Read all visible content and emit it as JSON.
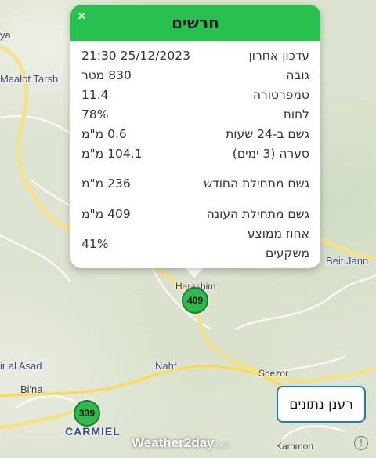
{
  "popup": {
    "title": "חרשים",
    "close_icon": "×",
    "rows": [
      {
        "label": "עדכון אחרון",
        "value": "25/12/2023 21:30"
      },
      {
        "label": "גובה",
        "value": "830 מטר"
      },
      {
        "label": "טמפרטורה",
        "value": "11.4"
      },
      {
        "label": "לחות",
        "value": "78%"
      },
      {
        "label": "גשם ב-24 שעות",
        "value": "0.6 מ\"מ"
      },
      {
        "label": "סערה (3 ימים)",
        "value": "104.1 מ\"מ"
      },
      {
        "label": "גשם מתחילת החודש",
        "value": "236 מ\"מ"
      },
      {
        "label": "גשם מתחילת העונה",
        "value": "409 מ\"מ"
      },
      {
        "label": "אחוז ממוצע משקעים",
        "value": "41%"
      }
    ]
  },
  "markers": [
    {
      "station": "Harashim",
      "value": "409"
    },
    {
      "station": "Carmiel",
      "value": "339"
    }
  ],
  "map_labels": {
    "ya": "ya",
    "maalot": "Maalot Tarsh",
    "beit_jann": "Beit Jann",
    "harashim": "Harashim",
    "ir_al_asad": "ir al Asad",
    "nahf": "Nahf",
    "shezor": "Shezor",
    "bina": "Bi'na",
    "carmiel": "CARMIEL",
    "kammon": "Kammon"
  },
  "refresh_label": "רענן נתונים",
  "logo": {
    "main": "Weather2day",
    "suffix": ".co.il"
  },
  "info_icon": "!"
}
